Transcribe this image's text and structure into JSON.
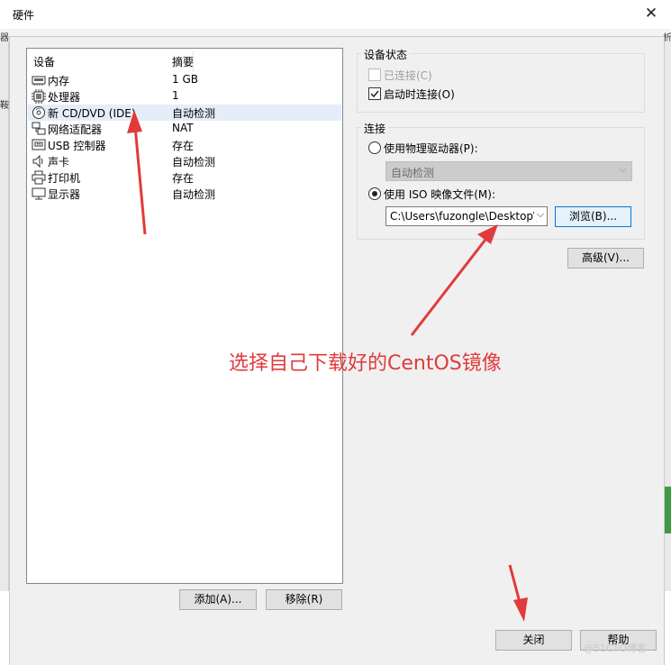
{
  "window": {
    "title": "硬件",
    "close_glyph": "✕"
  },
  "background_fragments": {
    "left": "器",
    "right": "析",
    "left2": "鞍"
  },
  "device_list": {
    "headers": {
      "device": "设备",
      "summary": "摘要"
    },
    "rows": [
      {
        "icon": "memory-icon",
        "name": "内存",
        "summary": "1 GB"
      },
      {
        "icon": "processor-icon",
        "name": "处理器",
        "summary": "1"
      },
      {
        "icon": "cd-dvd-icon",
        "name": "新 CD/DVD (IDE)",
        "summary": "自动检测",
        "selected": true
      },
      {
        "icon": "network-adapter-icon",
        "name": "网络适配器",
        "summary": "NAT"
      },
      {
        "icon": "usb-icon",
        "name": "USB 控制器",
        "summary": "存在"
      },
      {
        "icon": "sound-card-icon",
        "name": "声卡",
        "summary": "自动检测"
      },
      {
        "icon": "printer-icon",
        "name": "打印机",
        "summary": "存在"
      },
      {
        "icon": "display-icon",
        "name": "显示器",
        "summary": "自动检测"
      }
    ]
  },
  "list_buttons": {
    "add": "添加(A)...",
    "remove": "移除(R)"
  },
  "device_status": {
    "title": "设备状态",
    "connected": {
      "label": "已连接(C)",
      "checked": false,
      "enabled": false
    },
    "connect_on_start": {
      "label": "启动时连接(O)",
      "checked": true
    }
  },
  "connection": {
    "title": "连接",
    "physical": {
      "label": "使用物理驱动器(P):",
      "selected": false,
      "select_value": "自动检测"
    },
    "iso": {
      "label": "使用 ISO 映像文件(M):",
      "selected": true,
      "value": "C:\\Users\\fuzongle\\Desktop\\C"
    },
    "browse": "浏览(B)..."
  },
  "advanced": "高级(V)...",
  "footer": {
    "close": "关闭",
    "help": "帮助"
  },
  "annotation": {
    "text": "选择自己下载好的CentOS镜像",
    "color": "#e23a3a"
  },
  "watermark": "@51CTO博客"
}
